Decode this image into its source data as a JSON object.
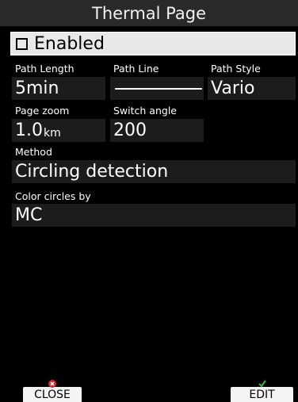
{
  "title": "Thermal Page",
  "enabled": {
    "label": "Enabled",
    "checked": false
  },
  "path_length": {
    "label": "Path Length",
    "value": "5min"
  },
  "path_line": {
    "label": "Path Line"
  },
  "path_style": {
    "label": "Path Style",
    "value": "Vario"
  },
  "page_zoom": {
    "label": "Page zoom",
    "value": "1.0",
    "unit": "km"
  },
  "switch_angle": {
    "label": "Switch angle",
    "value": "200"
  },
  "method": {
    "label": "Method",
    "value": "Circling detection"
  },
  "color_circles": {
    "label": "Color circles by",
    "value": "MC"
  },
  "buttons": {
    "close": "CLOSE",
    "edit": "EDIT"
  },
  "colors": {
    "close_mark": "#d62828",
    "edit_mark": "#3aaa35"
  }
}
